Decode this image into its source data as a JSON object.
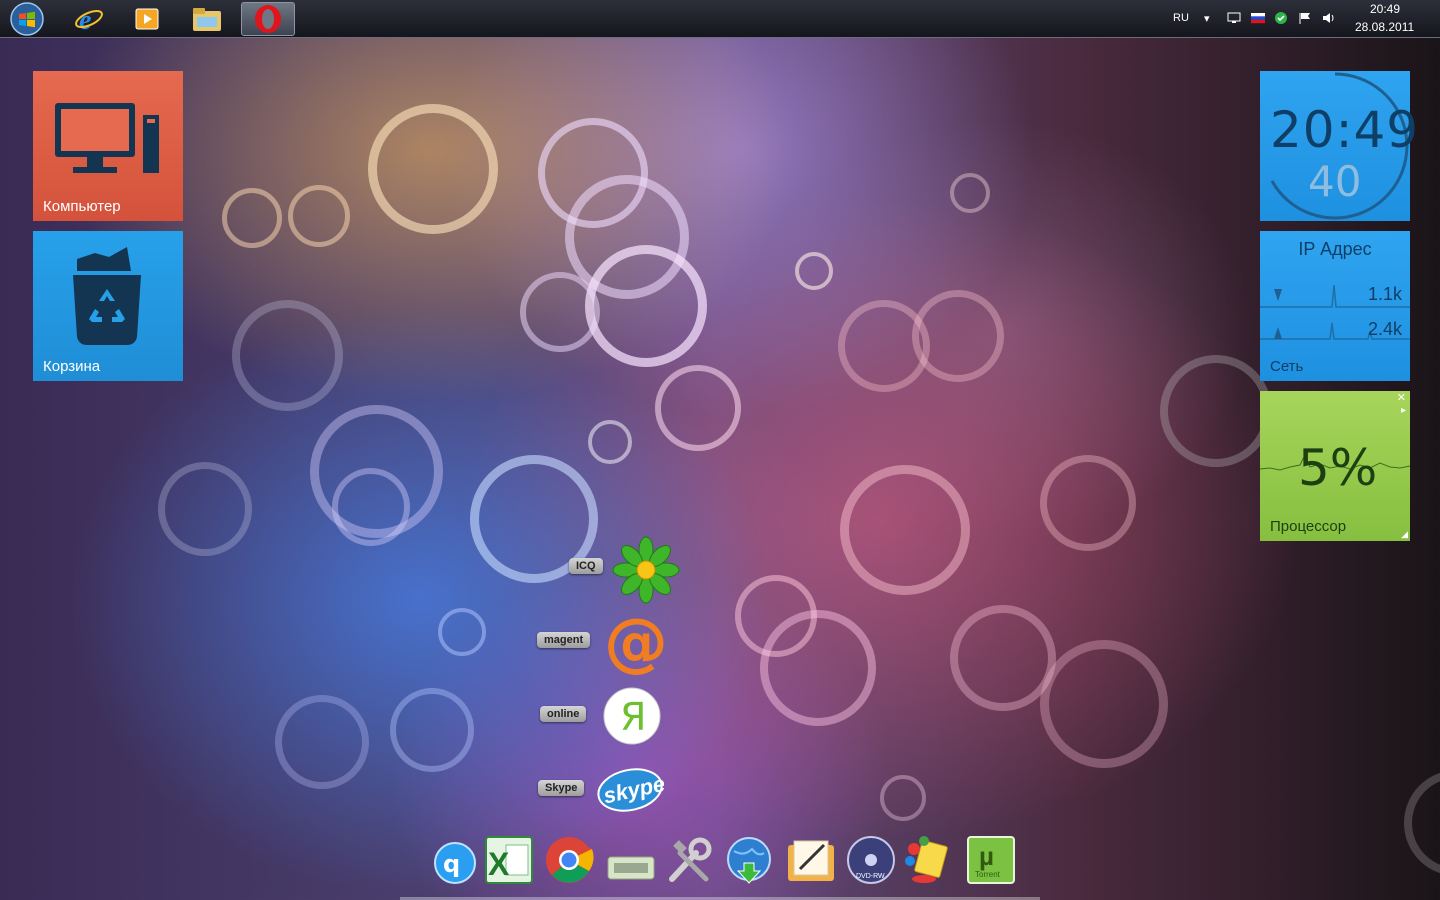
{
  "taskbar": {
    "pinned": [
      {
        "name": "start-orb-icon"
      },
      {
        "name": "internet-explorer-icon"
      },
      {
        "name": "media-player-icon"
      },
      {
        "name": "file-explorer-icon"
      },
      {
        "name": "opera-icon",
        "active": true
      }
    ],
    "tray": {
      "language": "RU",
      "time": "20:49",
      "date": "28.08.2011"
    }
  },
  "tiles": {
    "computer": {
      "label": "Компьютер",
      "color": "#e05f46"
    },
    "recycle": {
      "label": "Корзина",
      "color": "#2398e2"
    },
    "clock": {
      "time": "20:49",
      "seconds": "40"
    },
    "network": {
      "title": "IP Адрес",
      "down": "1.1k",
      "up": "2.4k",
      "label": "Сеть"
    },
    "cpu": {
      "percent": "5%",
      "label": "Процессор",
      "color": "#98ca4c"
    }
  },
  "messengers": [
    {
      "label": "ICQ",
      "icon": "icq-flower-icon"
    },
    {
      "label": "magent",
      "icon": "mail-agent-icon"
    },
    {
      "label": "online",
      "icon": "yandex-online-icon"
    },
    {
      "label": "Skype",
      "icon": "skype-icon"
    }
  ],
  "dock": {
    "items": [
      {
        "icon": "qip-icon"
      },
      {
        "icon": "excel-icon",
        "letter": "X"
      },
      {
        "icon": "chrome-icon"
      },
      {
        "icon": "drive-icon"
      },
      {
        "icon": "tools-icon"
      },
      {
        "icon": "globe-download-icon"
      },
      {
        "icon": "notes-folder-icon"
      },
      {
        "icon": "dvd-rw-icon",
        "text": "DVD-RW"
      },
      {
        "icon": "paint-icon"
      },
      {
        "icon": "utorrent-icon",
        "text": "Torrent"
      }
    ]
  }
}
